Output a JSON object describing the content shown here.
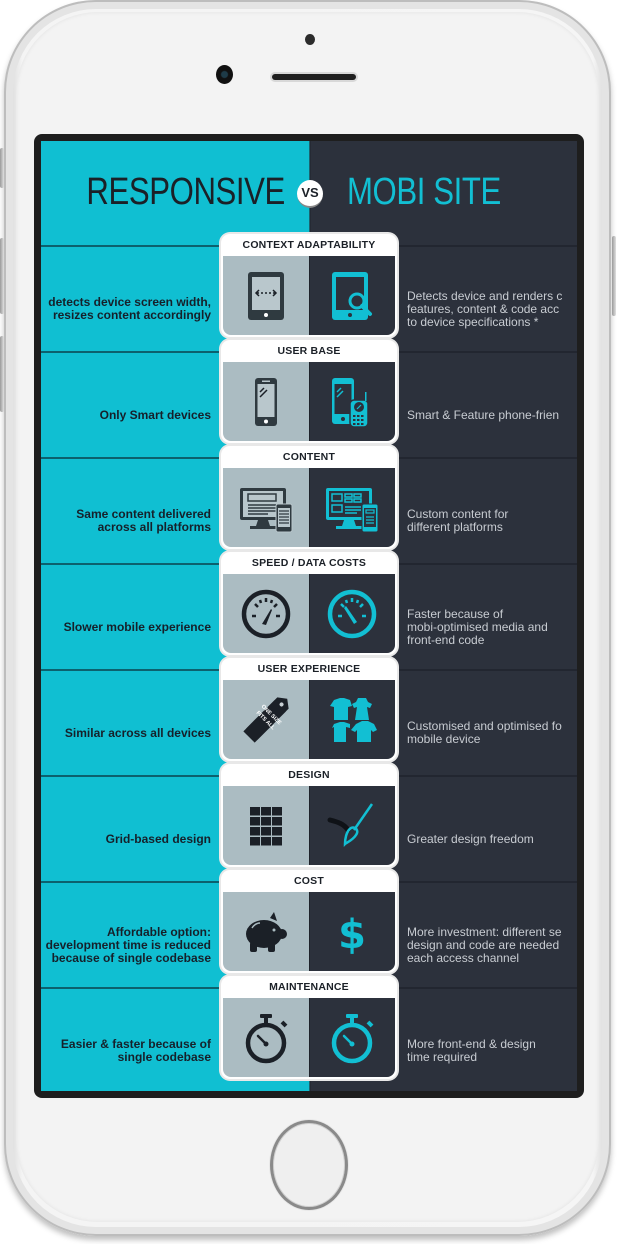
{
  "header": {
    "left_title": "RESPONSIVE",
    "vs_label": "VS",
    "right_title": "MOBI SITE"
  },
  "colors": {
    "responsive_bg": "#10bfd2",
    "mobi_bg": "#2c313c",
    "card_left_bg": "#abbcc2",
    "accent": "#12bfd3",
    "dark_icon": "#1b2027"
  },
  "rows": [
    {
      "title": "CONTEXT ADAPTABILITY",
      "left_icon": "tablet-resize-icon",
      "right_icon": "tablet-search-icon",
      "left_text": "detects device screen width,\nresizes content accordingly",
      "right_text": "Detects device and renders c\nfeatures, content & code acc\nto device specifications *"
    },
    {
      "title": "USER BASE",
      "left_icon": "smartphone-icon",
      "right_icon": "smartphone-feature-phone-icon",
      "left_text": "Only Smart devices",
      "right_text": "Smart & Feature phone-frien"
    },
    {
      "title": "CONTENT",
      "left_icon": "desktop-mobile-same-content-icon",
      "right_icon": "desktop-mobile-custom-content-icon",
      "left_text": "Same content delivered\nacross all platforms",
      "right_text": "Custom content for\ndifferent platforms"
    },
    {
      "title": "SPEED / DATA COSTS",
      "left_icon": "speedometer-slow-icon",
      "right_icon": "speedometer-fast-icon",
      "left_text": "Slower mobile experience",
      "right_text": "Faster because of\nmobi-optimised media and\nfront-end code"
    },
    {
      "title": "USER EXPERIENCE",
      "left_icon": "one-size-fits-all-tag-icon",
      "right_icon": "shirts-icon",
      "left_text": "Similar across all devices",
      "right_text": "Customised and optimised fo\nmobile device",
      "tag_text": "ONE SIZE FITS ALL"
    },
    {
      "title": "DESIGN",
      "left_icon": "grid-icon",
      "right_icon": "paintbrush-icon",
      "left_text": "Grid-based design",
      "right_text": "Greater design freedom"
    },
    {
      "title": "COST",
      "left_icon": "piggy-bank-icon",
      "right_icon": "dollar-icon",
      "left_text": "Affordable option:\ndevelopment time is reduced\nbecause of single codebase",
      "right_text": "More investment: different se\ndesign and code are needed\neach access channel"
    },
    {
      "title": "MAINTENANCE",
      "left_icon": "stopwatch-icon",
      "right_icon": "stopwatch-icon",
      "left_text": "Easier & faster because of\nsingle codebase",
      "right_text": "More front-end & design\ntime required"
    }
  ]
}
